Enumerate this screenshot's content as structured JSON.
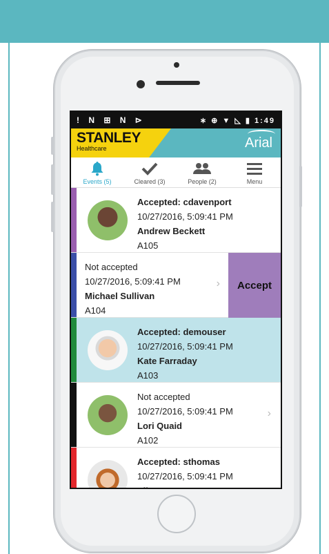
{
  "status_bar": {
    "left_icons": "! N ⊞ N ⊳",
    "right_icons": "∗ ⊕ ▼ ◺ ▮",
    "time": "1:49"
  },
  "brand": {
    "name": "STANLEY",
    "sub": "Healthcare",
    "app": "Arial"
  },
  "tabs": [
    {
      "label": "Events (5)",
      "icon": "bell-icon",
      "active": true
    },
    {
      "label": "Cleared (3)",
      "icon": "checkmark-icon"
    },
    {
      "label": "People (2)",
      "icon": "people-icon"
    },
    {
      "label": "Menu",
      "icon": "hamburger-menu-icon"
    }
  ],
  "events": [
    {
      "status": "Accepted: cdavenport",
      "datetime": "10/27/2016, 5:09:41 PM",
      "name": "Andrew Beckett",
      "room": "A105",
      "bar_color": "#9b5fb0",
      "bg": "#ffffff"
    },
    {
      "status": "Not accepted",
      "datetime": "10/27/2016, 5:09:41 PM",
      "name": "Michael Sullivan",
      "room": "A104",
      "bar_color": "#3b4fa8",
      "bg": "#ffffff",
      "action": "Accept",
      "action_color": "#9f7dbb"
    },
    {
      "status": "Accepted: demouser",
      "datetime": "10/27/2016, 5:09:41 PM",
      "name": "Kate Farraday",
      "room": "A103",
      "bar_color": "#1f8a3c",
      "bg": "#bfe3ea"
    },
    {
      "status": "Not accepted",
      "datetime": "10/27/2016, 5:09:41 PM",
      "name": "Lori Quaid",
      "room": "A102",
      "bar_color": "#111111",
      "bg": "#ffffff"
    },
    {
      "status": "Accepted: sthomas",
      "datetime": "10/27/2016, 5:09:41 PM",
      "name": "Elise Graves",
      "room": "",
      "bar_color": "#e2262b",
      "bg": "#ffffff"
    }
  ],
  "colors": {
    "teal": "#5bb7c0",
    "yellow": "#f5d20e",
    "active_tab": "#2aa7c9"
  }
}
